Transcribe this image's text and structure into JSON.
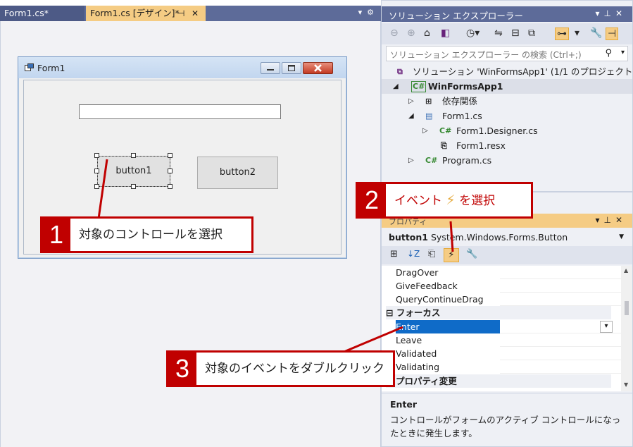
{
  "tabs": [
    {
      "label": "Form1.cs*",
      "active": false
    },
    {
      "label": "Form1.cs [デザイン]*",
      "active": true
    }
  ],
  "designer": {
    "form_title": "Form1",
    "textbox_value": "",
    "button1_label": "button1",
    "button2_label": "button2"
  },
  "solution_explorer": {
    "title": "ソリューション エクスプローラー",
    "search_placeholder": "ソリューション エクスプローラー の検索 (Ctrl+;)",
    "tree": [
      {
        "label": "ソリューション 'WinFormsApp1' (1/1 のプロジェクト)",
        "icon": "solution-icon"
      },
      {
        "label": "WinFormsApp1",
        "icon": "csharp-project-icon",
        "bold": true
      },
      {
        "label": "依存関係",
        "icon": "dependencies-icon"
      },
      {
        "label": "Form1.cs",
        "icon": "form-icon"
      },
      {
        "label": "Form1.Designer.cs",
        "icon": "csharp-file-icon"
      },
      {
        "label": "Form1.resx",
        "icon": "resource-file-icon"
      },
      {
        "label": "Program.cs",
        "icon": "csharp-file-icon"
      }
    ],
    "csharp_badge": "C#"
  },
  "properties": {
    "title": "プロパティ",
    "object_name": "button1",
    "object_type": "System.Windows.Forms.Button",
    "rows_before": [
      "DragOver",
      "GiveFeedback",
      "QueryContinueDrag"
    ],
    "category": "フォーカス",
    "category_toggle": "⊟",
    "selected_row": "Enter",
    "rows_after": [
      "Leave",
      "Validated",
      "Validating"
    ],
    "next_category": "プロパティ変更",
    "desc_title": "Enter",
    "desc_text": "コントロールがフォームのアクティブ コントロールになったときに発生します。"
  },
  "callouts": [
    {
      "number": "1",
      "text": "対象のコントロールを選択"
    },
    {
      "number": "2",
      "text_before": "イベント",
      "icon": "lightning-icon",
      "text_after": "を選択"
    },
    {
      "number": "3",
      "text": "対象のイベントをダブルクリック"
    }
  ],
  "colors": {
    "accent_tab": "#f5cc84",
    "title_bar": "#5d6b99",
    "callout_red": "#c00000",
    "selection_blue": "#0f6bc8"
  }
}
